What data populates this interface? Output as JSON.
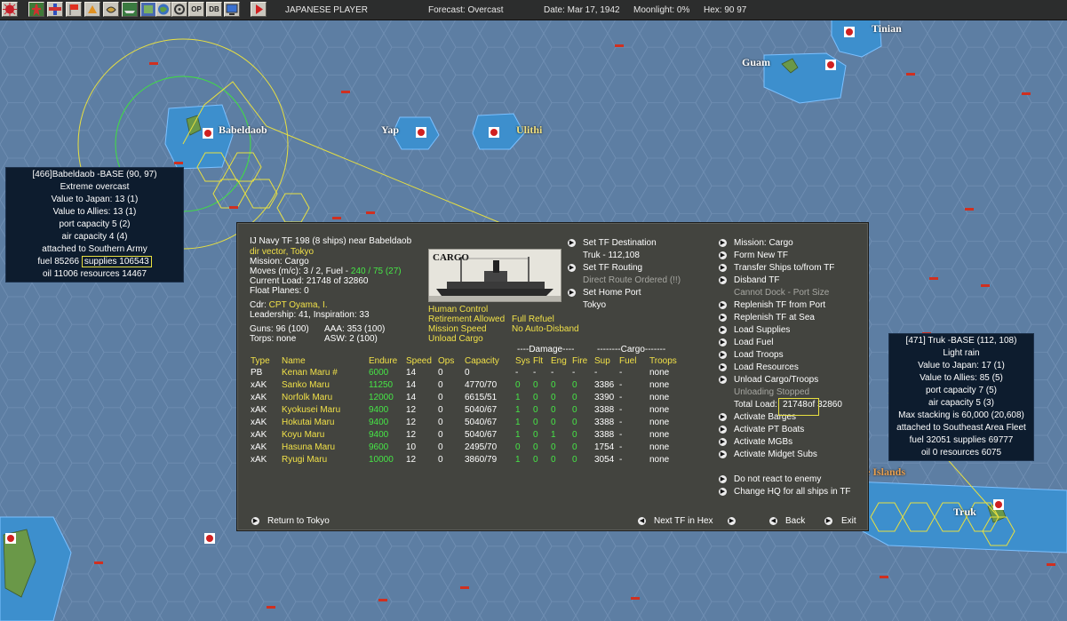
{
  "toolbar": {
    "player": "JAPANESE PLAYER",
    "forecast": "Forecast: Overcast",
    "date": "Date: Mar 17, 1942",
    "moonlight": "Moonlight: 0%",
    "hex": "Hex: 90 97",
    "buttons": [
      "rising-sun",
      "green-star",
      "red-cross",
      "flag",
      "triangle",
      "crest",
      "ship",
      "map",
      "globe",
      "settings",
      "OP",
      "DB",
      "monitor",
      "play"
    ]
  },
  "map": {
    "places": [
      "Tinian",
      "Guam",
      "Babeldaob",
      "Yap",
      "Ulithi",
      "Truk",
      "e Islands"
    ]
  },
  "babeldaob_box": {
    "lines": [
      "[466]Babeldaob -BASE (90, 97)",
      "Extreme overcast",
      "Value to Japan: 13 (1)",
      "Value to Allies: 13 (1)",
      "port capacity 5 (2)",
      "air capacity 4 (4)",
      "attached to Southern Army"
    ],
    "fuel": "fuel 85266",
    "supplies": "supplies 106543",
    "oil": "oil 11006  resources 14467"
  },
  "truk_box": {
    "lines": [
      "[471] Truk -BASE (112, 108)",
      "Light rain",
      "Value to Japan: 17 (1)",
      "Value to Allies: 85 (5)",
      "port capacity 7 (5)",
      "air capacity 5 (3)",
      "Max stacking is 60,000 (20,608)",
      "attached to Southeast Area Fleet",
      "fuel 32051  supplies 69777",
      "oil 0  resources 6075"
    ]
  },
  "tf": {
    "title": "IJ Navy TF 198 (8 ships)  near Babeldaob",
    "dir": "dir vector, Tokyo",
    "mission": "Mission:  Cargo",
    "moves": "Moves (m/c): 3 / 2, Fuel - ",
    "moves_fuel": "240 / 75 (27)",
    "current_load": "Current Load: 21748 of 32860",
    "float_planes": "Float Planes: 0",
    "cdr_label": "Cdr: ",
    "cdr": "CPT  Oyama, I.",
    "leadership": "Leadership: 41, Inspiration: 33",
    "guns": "Guns: 96 (100)",
    "aaa": "AAA: 353 (100)",
    "torps": "Torps: none",
    "asw": "ASW: 2 (100)",
    "image_caption": "CARGO",
    "options": [
      "Human Control",
      "Retirement Allowed",
      "Mission Speed",
      "Unload Cargo"
    ],
    "options2": [
      "Full Refuel",
      "No Auto-Disband"
    ],
    "mid_actions": [
      {
        "label": "Set TF Destination",
        "arrow": true,
        "style": ""
      },
      {
        "label": "Truk - 112,108",
        "arrow": false,
        "style": ""
      },
      {
        "label": "Set TF Routing",
        "arrow": true,
        "style": ""
      },
      {
        "label": "Direct Route Ordered (!!)",
        "arrow": false,
        "style": "gr"
      },
      {
        "label": "Set Home Port",
        "arrow": true,
        "style": ""
      },
      {
        "label": "Tokyo",
        "arrow": false,
        "style": ""
      }
    ],
    "right_actions": [
      {
        "label": "Mission: Cargo",
        "arrow": true,
        "style": ""
      },
      {
        "label": "Form New TF",
        "arrow": true,
        "style": ""
      },
      {
        "label": "Transfer Ships to/from TF",
        "arrow": true,
        "style": ""
      },
      {
        "label": "Disband TF",
        "arrow": true,
        "style": ""
      },
      {
        "label": "Cannot Dock - Port Size",
        "arrow": false,
        "style": "gr"
      },
      {
        "label": "Replenish TF from Port",
        "arrow": true,
        "style": ""
      },
      {
        "label": "Replenish TF at Sea",
        "arrow": true,
        "style": ""
      },
      {
        "label": "Load Supplies",
        "arrow": true,
        "style": ""
      },
      {
        "label": "Load Fuel",
        "arrow": true,
        "style": ""
      },
      {
        "label": "Load Troops",
        "arrow": true,
        "style": ""
      },
      {
        "label": "Load Resources",
        "arrow": true,
        "style": ""
      },
      {
        "label": "Unload Cargo/Troops",
        "arrow": true,
        "style": ""
      },
      {
        "label": "Unloading Stopped",
        "arrow": false,
        "style": "gr"
      },
      {
        "label": "Total Load: ",
        "arrow": false,
        "style": "",
        "extra": "21748",
        "extra2": " of 32860"
      },
      {
        "label": "Activate Barges",
        "arrow": true,
        "style": ""
      },
      {
        "label": "Activate PT Boats",
        "arrow": true,
        "style": ""
      },
      {
        "label": "Activate MGBs",
        "arrow": true,
        "style": ""
      },
      {
        "label": "Activate Midget Subs",
        "arrow": true,
        "style": ""
      },
      {
        "label": "",
        "arrow": false,
        "style": ""
      },
      {
        "label": "Do not react to enemy",
        "arrow": true,
        "style": ""
      },
      {
        "label": "Change HQ for all ships in TF",
        "arrow": true,
        "style": ""
      }
    ],
    "damage_header": "----Damage----",
    "cargo_header": "--------Cargo-------",
    "headers": [
      "Type",
      "Name",
      "Endure",
      "Speed",
      "Ops",
      "Capacity",
      "Sys",
      "Flt",
      "Eng",
      "Fire",
      "Sup",
      "Fuel",
      "Troops"
    ],
    "ships": [
      [
        "PB",
        "Kenan Maru #",
        "6000",
        "14",
        "0",
        "0",
        "-",
        "-",
        "-",
        "-",
        "-",
        "-",
        "none"
      ],
      [
        "xAK",
        "Sanko Maru",
        "11250",
        "14",
        "0",
        "4770/70",
        "0",
        "0",
        "0",
        "0",
        "3386",
        "-",
        "none"
      ],
      [
        "xAK",
        "Norfolk Maru",
        "12000",
        "14",
        "0",
        "6615/51",
        "1",
        "0",
        "0",
        "0",
        "3390",
        "-",
        "none"
      ],
      [
        "xAK",
        "Kyokusei Maru",
        "9400",
        "12",
        "0",
        "5040/67",
        "1",
        "0",
        "0",
        "0",
        "3388",
        "-",
        "none"
      ],
      [
        "xAK",
        "Hokutai Maru",
        "9400",
        "12",
        "0",
        "5040/67",
        "1",
        "0",
        "0",
        "0",
        "3388",
        "-",
        "none"
      ],
      [
        "xAK",
        "Koyu Maru",
        "9400",
        "12",
        "0",
        "5040/67",
        "1",
        "0",
        "1",
        "0",
        "3388",
        "-",
        "none"
      ],
      [
        "xAK",
        "Hasuna Maru",
        "9600",
        "10",
        "0",
        "2495/70",
        "0",
        "0",
        "0",
        "0",
        "1754",
        "-",
        "none"
      ],
      [
        "xAK",
        "Ryugi Maru",
        "10000",
        "12",
        "0",
        "3860/79",
        "1",
        "0",
        "0",
        "0",
        "3054",
        "-",
        "none"
      ]
    ],
    "footer": {
      "return": "Return to Tokyo",
      "next": "Next TF in Hex",
      "back": "Back",
      "exit": "Exit"
    }
  }
}
